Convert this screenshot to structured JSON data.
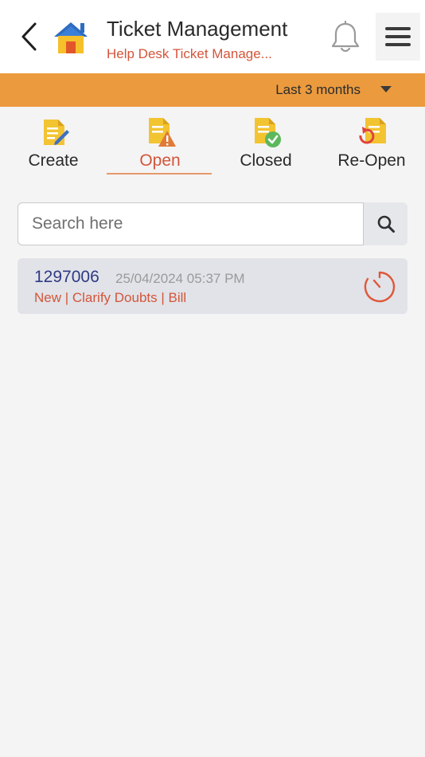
{
  "header": {
    "title": "Ticket Management",
    "subtitle": "Help Desk Ticket Manage..."
  },
  "icons": {
    "back": "chevron-left-icon",
    "home": "home-icon",
    "notifications": "bell-icon",
    "menu": "hamburger-menu-icon"
  },
  "filter": {
    "label": "Last 3 months"
  },
  "tabs": [
    {
      "label": "Create",
      "icon": "create-ticket-icon"
    },
    {
      "label": "Open",
      "icon": "open-ticket-icon",
      "active": true
    },
    {
      "label": "Closed",
      "icon": "closed-ticket-icon"
    },
    {
      "label": "Re-Open",
      "icon": "reopen-ticket-icon"
    }
  ],
  "search": {
    "placeholder": "Search here",
    "value": ""
  },
  "tickets": [
    {
      "id": "1297006",
      "datetime": "25/04/2024 05:37 PM",
      "meta": "New | Clarify Doubts | Bill"
    }
  ],
  "colors": {
    "accent": "#eb9a3e",
    "active": "#d4553a",
    "ticket_id": "#2f3a86",
    "background": "#f4f4f4"
  }
}
